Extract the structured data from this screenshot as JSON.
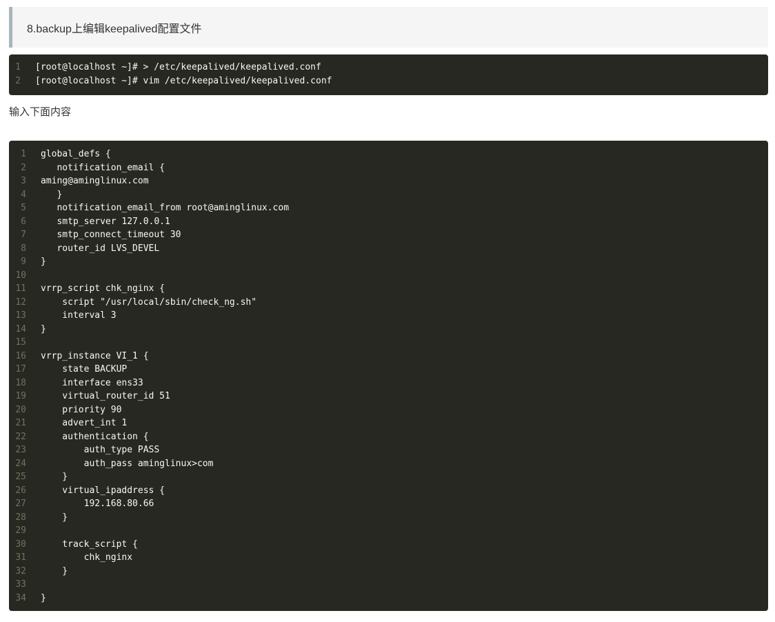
{
  "heading": "8.backup上编辑keepalived配置文件",
  "commands": [
    {
      "num": "1",
      "text": "[root@localhost ~]# > /etc/keepalived/keepalived.conf"
    },
    {
      "num": "2",
      "text": "[root@localhost ~]# vim /etc/keepalived/keepalived.conf"
    }
  ],
  "paragraph": "输入下面内容",
  "config": [
    {
      "num": "1",
      "text": "global_defs {"
    },
    {
      "num": "2",
      "text": "   notification_email {"
    },
    {
      "num": "3",
      "text": "aming@aminglinux.com"
    },
    {
      "num": "4",
      "text": "   }"
    },
    {
      "num": "5",
      "text": "   notification_email_from root@aminglinux.com"
    },
    {
      "num": "6",
      "text": "   smtp_server 127.0.0.1"
    },
    {
      "num": "7",
      "text": "   smtp_connect_timeout 30"
    },
    {
      "num": "8",
      "text": "   router_id LVS_DEVEL"
    },
    {
      "num": "9",
      "text": "}"
    },
    {
      "num": "10",
      "text": ""
    },
    {
      "num": "11",
      "text": "vrrp_script chk_nginx {"
    },
    {
      "num": "12",
      "text": "    script \"/usr/local/sbin/check_ng.sh\""
    },
    {
      "num": "13",
      "text": "    interval 3"
    },
    {
      "num": "14",
      "text": "}"
    },
    {
      "num": "15",
      "text": ""
    },
    {
      "num": "16",
      "text": "vrrp_instance VI_1 {"
    },
    {
      "num": "17",
      "text": "    state BACKUP"
    },
    {
      "num": "18",
      "text": "    interface ens33"
    },
    {
      "num": "19",
      "text": "    virtual_router_id 51"
    },
    {
      "num": "20",
      "text": "    priority 90"
    },
    {
      "num": "21",
      "text": "    advert_int 1"
    },
    {
      "num": "22",
      "text": "    authentication {"
    },
    {
      "num": "23",
      "text": "        auth_type PASS"
    },
    {
      "num": "24",
      "text": "        auth_pass aminglinux>com"
    },
    {
      "num": "25",
      "text": "    }"
    },
    {
      "num": "26",
      "text": "    virtual_ipaddress {"
    },
    {
      "num": "27",
      "text": "        192.168.80.66"
    },
    {
      "num": "28",
      "text": "    }"
    },
    {
      "num": "29",
      "text": ""
    },
    {
      "num": "30",
      "text": "    track_script {"
    },
    {
      "num": "31",
      "text": "        chk_nginx"
    },
    {
      "num": "32",
      "text": "    }"
    },
    {
      "num": "33",
      "text": ""
    },
    {
      "num": "34",
      "text": "}"
    }
  ]
}
